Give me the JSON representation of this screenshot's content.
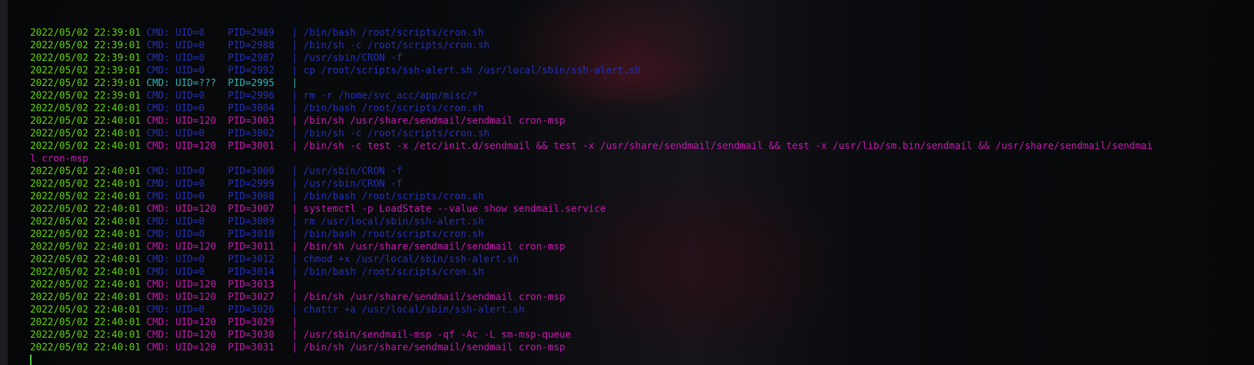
{
  "terminal": {
    "lines": [
      {
        "ts": "2022/05/02 22:39:01",
        "type": "uid0",
        "prefix": " CMD: UID=0    PID=2989   | ",
        "cmd": "/bin/bash /root/scripts/cron.sh"
      },
      {
        "ts": "2022/05/02 22:39:01",
        "type": "uid0",
        "prefix": " CMD: UID=0    PID=2988   | ",
        "cmd": "/bin/sh -c /root/scripts/cron.sh"
      },
      {
        "ts": "2022/05/02 22:39:01",
        "type": "uid0",
        "prefix": " CMD: UID=0    PID=2987   | ",
        "cmd": "/usr/sbin/CRON -f"
      },
      {
        "ts": "2022/05/02 22:39:01",
        "type": "uid0",
        "prefix": " CMD: UID=0    PID=2992   | ",
        "cmd": "cp /root/scripts/ssh-alert.sh /usr/local/sbin/ssh-alert.sh"
      },
      {
        "ts": "2022/05/02 22:39:01",
        "type": "uidq",
        "prefix": " CMD: UID=???  PID=2995   | ",
        "cmd": ""
      },
      {
        "ts": "2022/05/02 22:39:01",
        "type": "uid0",
        "prefix": " CMD: UID=0    PID=2996   | ",
        "cmd": "rm -r /home/svc_acc/app/misc/*"
      },
      {
        "ts": "2022/05/02 22:40:01",
        "type": "uid0",
        "prefix": " CMD: UID=0    PID=3004   | ",
        "cmd": "/bin/bash /root/scripts/cron.sh"
      },
      {
        "ts": "2022/05/02 22:40:01",
        "type": "uid120",
        "prefix": " CMD: UID=120  PID=3003   | ",
        "cmd": "/bin/sh /usr/share/sendmail/sendmail cron-msp"
      },
      {
        "ts": "2022/05/02 22:40:01",
        "type": "uid0",
        "prefix": " CMD: UID=0    PID=3002   | ",
        "cmd": "/bin/sh -c /root/scripts/cron.sh"
      },
      {
        "ts": "2022/05/02 22:40:01",
        "type": "uid120",
        "prefix": " CMD: UID=120  PID=3001   | ",
        "cmd": "/bin/sh -c test -x /etc/init.d/sendmail && test -x /usr/share/sendmail/sendmail && test -x /usr/lib/sm.bin/sendmail && /usr/share/sendmail/sendmai"
      },
      {
        "ts": "",
        "type": "uid120",
        "prefix": "",
        "cmd": "l cron-msp"
      },
      {
        "ts": "2022/05/02 22:40:01",
        "type": "uid0",
        "prefix": " CMD: UID=0    PID=3000   | ",
        "cmd": "/usr/sbin/CRON -f"
      },
      {
        "ts": "2022/05/02 22:40:01",
        "type": "uid0",
        "prefix": " CMD: UID=0    PID=2999   | ",
        "cmd": "/usr/sbin/CRON -f"
      },
      {
        "ts": "2022/05/02 22:40:01",
        "type": "uid0",
        "prefix": " CMD: UID=0    PID=3008   | ",
        "cmd": "/bin/bash /root/scripts/cron.sh"
      },
      {
        "ts": "2022/05/02 22:40:01",
        "type": "uid120",
        "prefix": " CMD: UID=120  PID=3007   | ",
        "cmd": "systemctl -p LoadState --value show sendmail.service"
      },
      {
        "ts": "2022/05/02 22:40:01",
        "type": "uid0",
        "prefix": " CMD: UID=0    PID=3009   | ",
        "cmd": "rm /usr/local/sbin/ssh-alert.sh"
      },
      {
        "ts": "2022/05/02 22:40:01",
        "type": "uid0",
        "prefix": " CMD: UID=0    PID=3010   | ",
        "cmd": "/bin/bash /root/scripts/cron.sh"
      },
      {
        "ts": "2022/05/02 22:40:01",
        "type": "uid120",
        "prefix": " CMD: UID=120  PID=3011   | ",
        "cmd": "/bin/sh /usr/share/sendmail/sendmail cron-msp"
      },
      {
        "ts": "2022/05/02 22:40:01",
        "type": "uid0",
        "prefix": " CMD: UID=0    PID=3012   | ",
        "cmd": "chmod +x /usr/local/sbin/ssh-alert.sh"
      },
      {
        "ts": "2022/05/02 22:40:01",
        "type": "uid0",
        "prefix": " CMD: UID=0    PID=3014   | ",
        "cmd": "/bin/bash /root/scripts/cron.sh"
      },
      {
        "ts": "2022/05/02 22:40:01",
        "type": "uid120",
        "prefix": " CMD: UID=120  PID=3013   | ",
        "cmd": ""
      },
      {
        "ts": "2022/05/02 22:40:01",
        "type": "uid120",
        "prefix": " CMD: UID=120  PID=3027   | ",
        "cmd": "/bin/sh /usr/share/sendmail/sendmail cron-msp"
      },
      {
        "ts": "2022/05/02 22:40:01",
        "type": "uid0",
        "prefix": " CMD: UID=0    PID=3026   | ",
        "cmd": "chattr +a /usr/local/sbin/ssh-alert.sh"
      },
      {
        "ts": "2022/05/02 22:40:01",
        "type": "uid120",
        "prefix": " CMD: UID=120  PID=3029   | ",
        "cmd": ""
      },
      {
        "ts": "2022/05/02 22:40:01",
        "type": "uid120",
        "prefix": " CMD: UID=120  PID=3030   | ",
        "cmd": "/usr/sbin/sendmail-msp -qf -Ac -L sm-msp-queue"
      },
      {
        "ts": "2022/05/02 22:40:01",
        "type": "uid120",
        "prefix": " CMD: UID=120  PID=3031   | ",
        "cmd": "/bin/sh /usr/share/sendmail/sendmail cron-msp"
      }
    ]
  },
  "colors": {
    "timestamp": "#5fd700",
    "uid0": "#2330b8",
    "uid120": "#c518b0",
    "uid_unknown": "#27b5b5",
    "background": "#050608"
  }
}
